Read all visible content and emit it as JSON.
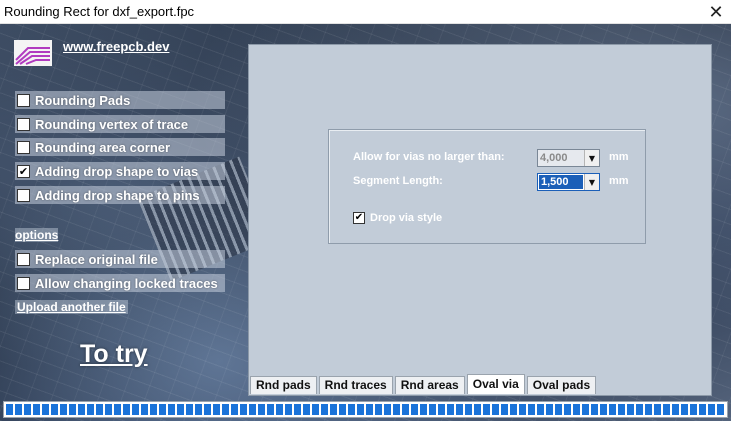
{
  "window": {
    "title": "Rounding Rect for dxf_export.fpc",
    "close_glyph": "✕"
  },
  "header": {
    "site_link": "www.freepcb.dev"
  },
  "options": [
    {
      "label": "Rounding Pads",
      "checked": false
    },
    {
      "label": "Rounding vertex of trace",
      "checked": false
    },
    {
      "label": "Rounding area corner",
      "checked": false
    },
    {
      "label": "Adding drop shape to vias",
      "checked": true
    },
    {
      "label": "Adding drop shape to pins",
      "checked": false
    }
  ],
  "options_link": "options",
  "extra_options": [
    {
      "label": "Replace original file",
      "checked": false
    },
    {
      "label": "Allow changing locked traces",
      "checked": false
    }
  ],
  "upload_link": "Upload another file",
  "try_link": "To try",
  "panel": {
    "vias_label": "Allow for vias no larger than:",
    "vias_value": "4,000",
    "vias_unit": "mm",
    "segment_label": "Segment Length:",
    "segment_value": "1,500",
    "segment_unit": "mm",
    "drop_style_label": "Drop via style",
    "drop_style_checked": true
  },
  "tabs": [
    {
      "label": "Rnd pads",
      "active": false
    },
    {
      "label": "Rnd traces",
      "active": false
    },
    {
      "label": "Rnd areas",
      "active": false
    },
    {
      "label": "Oval via",
      "active": true
    },
    {
      "label": "Oval pads",
      "active": false
    }
  ],
  "progress": {
    "fraction": 1.0
  },
  "icons": {
    "logo": "freepcb-logo",
    "check": "✔",
    "combo_arrow": "▼"
  }
}
